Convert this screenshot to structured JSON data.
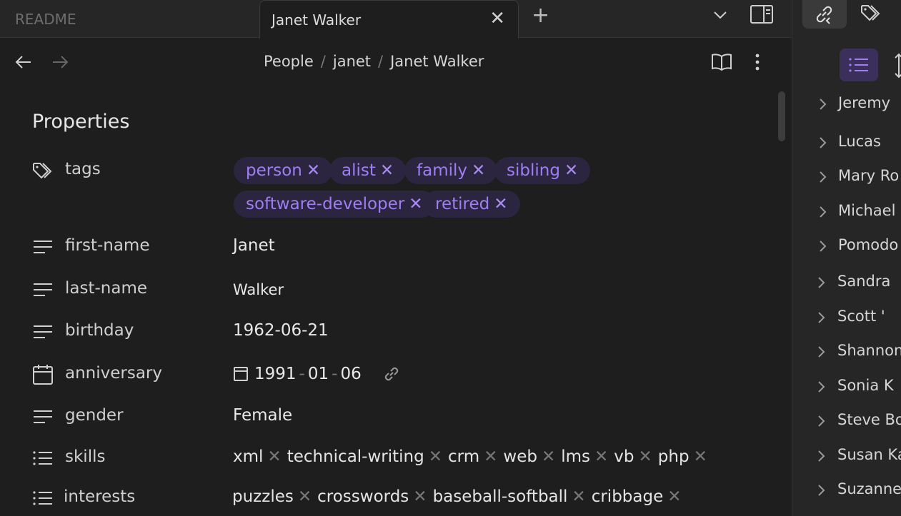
{
  "tabs": {
    "inactive_label": "README",
    "active_label": "Janet Walker",
    "new_tab": "+"
  },
  "breadcrumb": {
    "items": [
      "People",
      "janet",
      "Janet Walker"
    ],
    "separator": "/"
  },
  "properties": {
    "heading": "Properties",
    "tags": {
      "key": "tags",
      "values": [
        "person",
        "alist",
        "family",
        "sibling",
        "software-developer",
        "retired"
      ]
    },
    "first_name": {
      "key": "first-name",
      "value": "Janet"
    },
    "last_name": {
      "key": "last-name",
      "value": "Walker"
    },
    "birthday": {
      "key": "birthday",
      "value": "1962-06-21"
    },
    "anniversary": {
      "key": "anniversary",
      "year": "1991",
      "month": "01",
      "day": "06"
    },
    "gender": {
      "key": "gender",
      "value": "Female"
    },
    "skills": {
      "key": "skills",
      "values": [
        "xml",
        "technical-writing",
        "crm",
        "web",
        "lms",
        "vb",
        "php"
      ]
    },
    "interests": {
      "key": "interests",
      "values": [
        "puzzles",
        "crosswords",
        "baseball-softball",
        "cribbage"
      ]
    }
  },
  "right_panel": {
    "items": [
      "Jeremy",
      "Lucas",
      "Mary Ro",
      "Michael",
      "Pomodo",
      "Sandra",
      "Scott '",
      "Shannon",
      "Sonia K",
      "Steve Bo",
      "Susan Ka",
      "Suzanne"
    ]
  },
  "colors": {
    "accent": "#9f7ef4",
    "pill_bg": "#2c2540",
    "background": "#1e1e1e",
    "panel_bg": "#262626"
  },
  "icons": {
    "tab_close": "close-icon",
    "back": "arrow-left-icon",
    "forward": "arrow-right-icon",
    "reading_view": "book-open-icon",
    "more": "more-vertical-icon",
    "tags_prop": "tags-icon",
    "text_prop": "text-lines-icon",
    "date_prop": "calendar-icon",
    "list_prop": "list-icon",
    "link": "link-icon"
  }
}
